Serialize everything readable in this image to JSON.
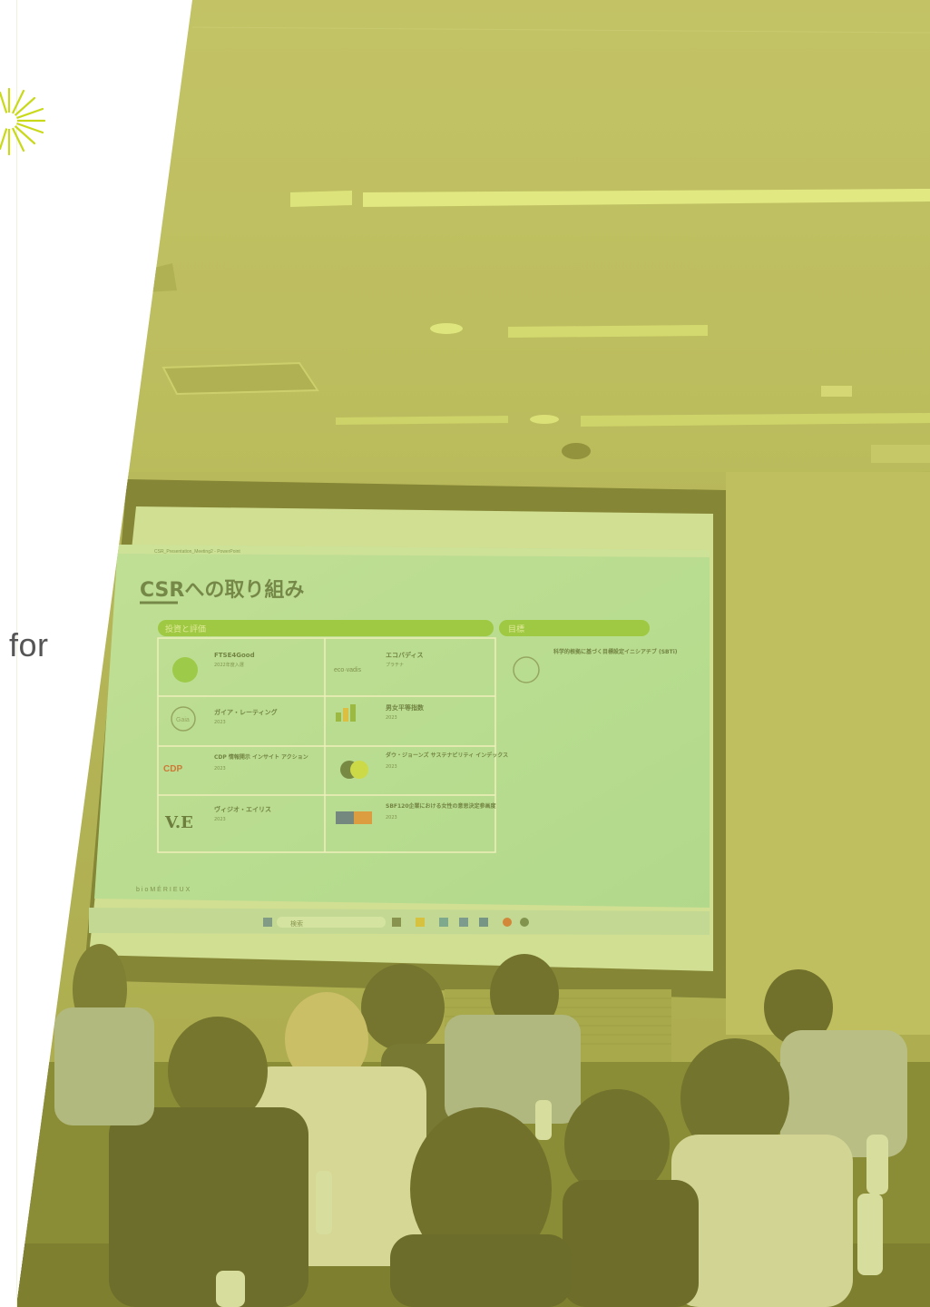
{
  "page": {
    "side_text": "for"
  },
  "slide": {
    "window_title": "CSR_Presentation_Meeting2 - PowerPoint",
    "title": "CSRへの取り組み",
    "section_left": "投資と評価",
    "section_right": "目標",
    "cells": [
      {
        "name": "FTSE4Good",
        "sub": "2022年度入選"
      },
      {
        "name": "エコバディス",
        "sub": "プラチナ"
      },
      {
        "name": "ガイア・レーティング",
        "sub": "2023"
      },
      {
        "name": "男女平等指数",
        "sub": "2023"
      },
      {
        "name": "CDP 情報開示 インサイト アクション",
        "sub": "2023"
      },
      {
        "name": "ダウ・ジョーンズ サステナビリティ インデックス",
        "sub": "2023"
      },
      {
        "name": "ヴィジオ・エイリス",
        "sub": "2023"
      },
      {
        "name": "SBF120企業における女性の意思決定参画度",
        "sub": "2023"
      }
    ],
    "right_title": "科学的根拠に基づく目標設定イニシアチブ (SBTi)",
    "footer_brand": "bioMÉRIEUX",
    "taskbar_search": "検索"
  },
  "colors": {
    "overlay": "#d6d64a",
    "slide_bg": "#a6e3bd",
    "green_bar": "#7ec23f",
    "burst": "#c9d91a"
  }
}
